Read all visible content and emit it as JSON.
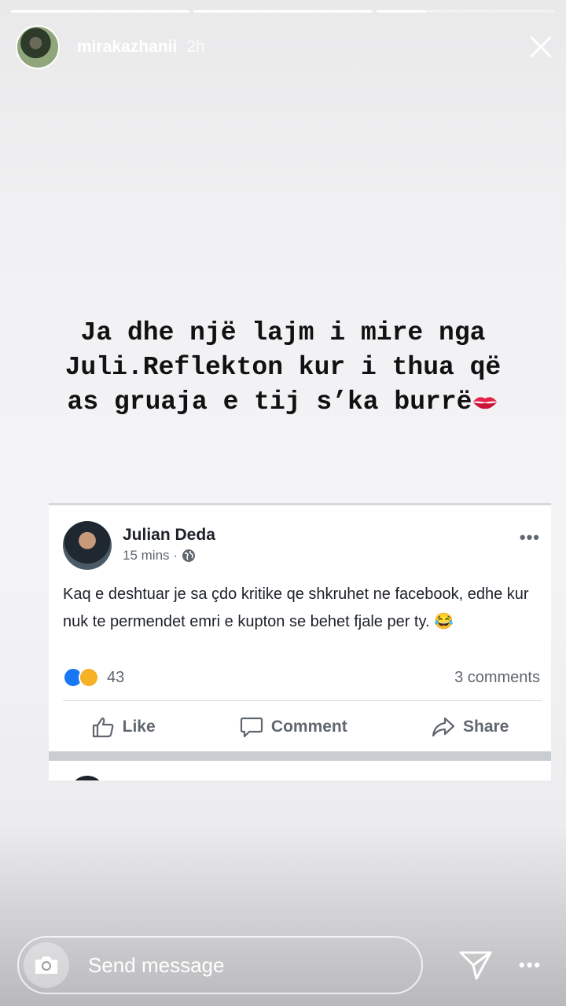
{
  "story": {
    "progress": [
      1.0,
      1.0,
      0.28
    ],
    "username": "mirakazhanii",
    "time": "2h",
    "text_lines": [
      "Ja dhe një lajm i mire nga",
      "Juli.Reflekton kur i thua që",
      "as gruaja e tij s’ka burrë"
    ]
  },
  "post": {
    "author": "Julian Deda",
    "time": "15 mins",
    "privacy_icon": "globe-icon",
    "body": "Kaq e deshtuar je sa çdo kritike qe shkruhet ne facebook, edhe kur nuk te permendet emri e kupton se behet fjale per ty. 😂",
    "reaction_count": "43",
    "comments_label": "3 comments",
    "actions": {
      "like": "Like",
      "comment": "Comment",
      "share": "Share"
    }
  },
  "composer": {
    "placeholder": "Send message"
  },
  "colors": {
    "facebook_blue": "#1877f2",
    "haha_yellow": "#f7b125",
    "kiss_red": "#e8234b"
  }
}
